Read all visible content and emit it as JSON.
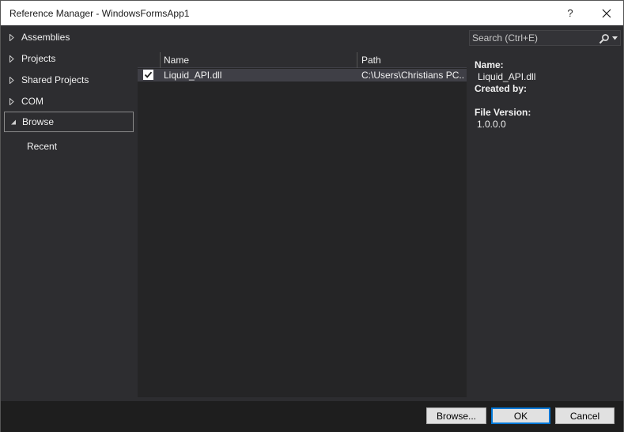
{
  "window": {
    "title": "Reference Manager - WindowsFormsApp1",
    "help_label": "?"
  },
  "nav": {
    "items": [
      {
        "label": "Assemblies",
        "expanded": false
      },
      {
        "label": "Projects",
        "expanded": false
      },
      {
        "label": "Shared Projects",
        "expanded": false
      },
      {
        "label": "COM",
        "expanded": false
      },
      {
        "label": "Browse",
        "expanded": true,
        "selected": true
      }
    ],
    "sub_items": [
      {
        "label": "Recent"
      }
    ]
  },
  "search": {
    "placeholder": "Search (Ctrl+E)",
    "value": ""
  },
  "list": {
    "columns": [
      "Name",
      "Path"
    ],
    "rows": [
      {
        "checked": true,
        "name": "Liquid_API.dll",
        "path": "C:\\Users\\Christians PC..."
      }
    ]
  },
  "details": {
    "name_label": "Name:",
    "name_value": "Liquid_API.dll",
    "created_by_label": "Created by:",
    "created_by_value": "",
    "file_version_label": "File Version:",
    "file_version_value": "1.0.0.0"
  },
  "footer": {
    "browse_label": "Browse...",
    "ok_label": "OK",
    "cancel_label": "Cancel"
  },
  "colors": {
    "background": "#2d2d30",
    "list_background": "#252526",
    "selected_row": "#3f3f46",
    "footer": "#1e1e1e",
    "accent": "#0078d7"
  }
}
